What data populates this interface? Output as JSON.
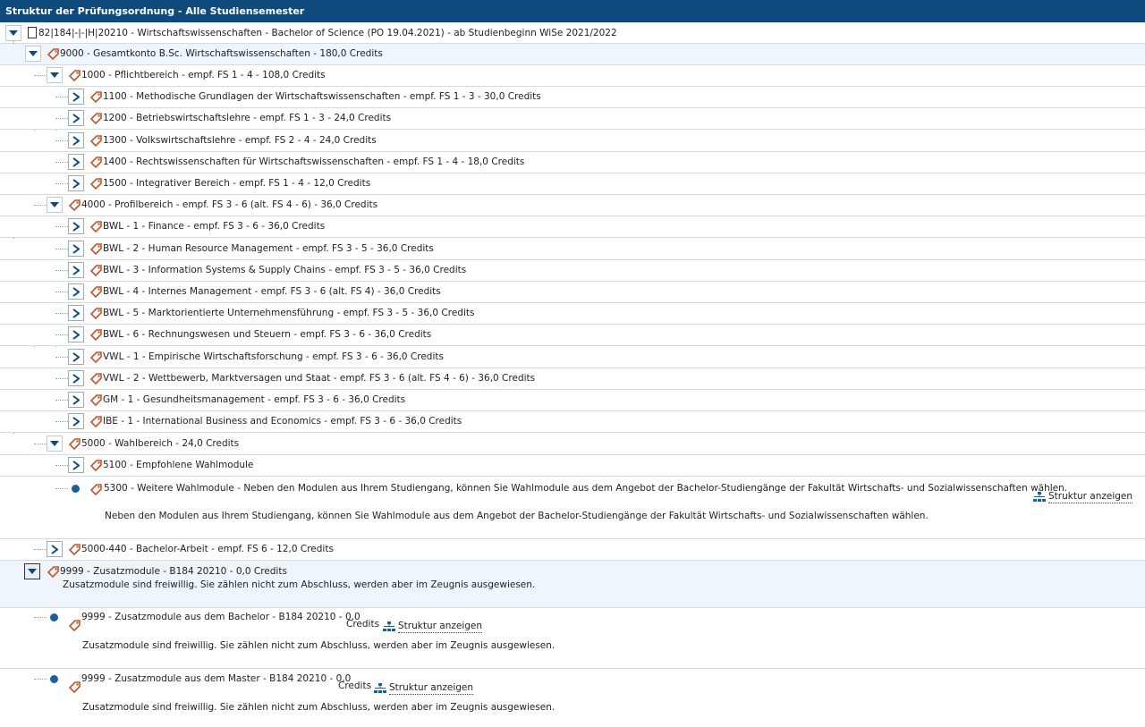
{
  "title": "Struktur der Prüfungsordnung - Alle Studiensemester",
  "root": {
    "label": "82|184|-|-|H|20210 - Wirtschaftswissenschaften - Bachelor of Science (PO 19.04.2021) - ab Studienbeginn WiSe 2021/2022"
  },
  "rows": [
    {
      "label": "9000 - Gesamtkonto B.Sc. Wirtschaftswissenschaften - 180,0 Credits"
    },
    {
      "label": "1000 - Pflichtbereich - empf. FS 1 - 4 - 108,0 Credits"
    },
    {
      "label": "1100 - Methodische Grundlagen der Wirtschaftswissenschaften - empf. FS 1 - 3 - 30,0 Credits"
    },
    {
      "label": "1200 - Betriebswirtschaftslehre - empf. FS 1 - 3 - 24,0 Credits"
    },
    {
      "label": "1300 - Volkswirtschaftslehre - empf. FS 2 - 4 - 24,0 Credits"
    },
    {
      "label": "1400 - Rechtswissenschaften für Wirtschaftswissenschaften - empf. FS 1 - 4 - 18,0 Credits"
    },
    {
      "label": "1500 - Integrativer Bereich - empf. FS 1 - 4 - 12,0 Credits"
    },
    {
      "label": "4000 - Profilbereich - empf. FS 3 - 6 (alt. FS 4 - 6) - 36,0 Credits"
    },
    {
      "label": "BWL - 1 - Finance - empf. FS 3 - 6 - 36,0 Credits"
    },
    {
      "label": "BWL - 2 - Human Resource Management - empf. FS 3 - 5 - 36,0 Credits"
    },
    {
      "label": "BWL - 3 - Information Systems & Supply Chains - empf. FS 3 - 5 - 36,0 Credits"
    },
    {
      "label": "BWL - 4 - Internes Management - empf. FS 3 - 6 (alt. FS 4) - 36,0 Credits"
    },
    {
      "label": "BWL - 5 - Marktorientierte Unternehmensführung - empf. FS 3 - 5 - 36,0 Credits"
    },
    {
      "label": "BWL - 6 - Rechnungswesen und Steuern - empf. FS 3 - 6 - 36,0 Credits"
    },
    {
      "label": "VWL - 1 - Empirische Wirtschaftsforschung - empf. FS 3 - 6 - 36,0 Credits"
    },
    {
      "label": "VWL - 2 - Wettbewerb, Marktversagen und Staat - empf. FS 3 - 6 (alt. FS 4 - 6) - 36,0 Credits"
    },
    {
      "label": "GM - 1 - Gesundheitsmanagement - empf. FS 3 - 6 - 36,0 Credits"
    },
    {
      "label": "IBE - 1 - International Business and Economics - empf. FS 3 - 6 - 36,0 Credits"
    },
    {
      "label": "5000 - Wahlbereich - 24,0 Credits"
    },
    {
      "label": "5100 - Empfohlene Wahlmodule"
    }
  ],
  "wahl5300": {
    "label": "5300 - Weitere Wahlmodule - Neben den Modulen aus Ihrem Studiengang, können Sie Wahlmodule aus dem Angebot der Bachelor-Studiengänge der Fakultät Wirtschafts- und Sozialwissenschaften wählen.",
    "desc": "Neben den Modulen aus Ihrem Studiengang, können Sie Wahlmodule aus dem Angebot der Bachelor-Studiengänge der Fakultät Wirtschafts- und Sozialwissenschaften wählen.",
    "link": "Struktur anzeigen"
  },
  "bachelorarbeit": {
    "label": "5000-440 - Bachelor-Arbeit - empf. FS 6 - 12,0 Credits"
  },
  "zusatz": {
    "label": "9999 - Zusatzmodule - B184 20210 - 0,0 Credits",
    "desc": "Zusatzmodule sind freiwillig. Sie zählen nicht zum Abschluss, werden aber im Zeugnis ausgewiesen."
  },
  "zusatzBachelor": {
    "label": "9999 - Zusatzmodule aus dem Bachelor - B184 20210 - 0,0",
    "credits": "Credits",
    "link": "Struktur anzeigen",
    "desc": "Zusatzmodule sind freiwillig. Sie zählen nicht zum Abschluss, werden aber im Zeugnis ausgewiesen."
  },
  "zusatzMaster": {
    "label": "9999 - Zusatzmodule aus dem Master - B184 20210 - 0,0",
    "credits": "Credits",
    "link": "Struktur anzeigen",
    "desc": "Zusatzmodule sind freiwillig. Sie zählen nicht zum Abschluss, werden aber im Zeugnis ausgewiesen."
  },
  "colors": {
    "titlebar": "#0e4a7c",
    "chevron": "#0e4a7c",
    "tag": "#c0552b",
    "dot": "#1a5e9e",
    "highlight": "#eef5fb"
  },
  "icons": {
    "expanded": "chevron-down-icon",
    "collapsed": "chevron-right-icon",
    "tag": "tag-icon",
    "leaf": "dot-icon",
    "structure": "hierarchy-icon",
    "document": "document-icon"
  }
}
